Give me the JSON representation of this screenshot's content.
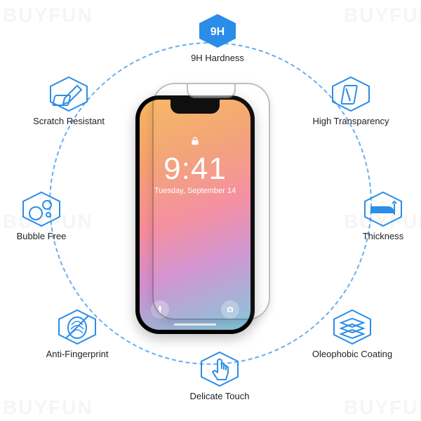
{
  "watermark": "BUYFUN",
  "phone": {
    "time": "9:41",
    "date": "Tuesday, September 14"
  },
  "features": {
    "hardness": {
      "label": "9H Hardness",
      "icon": "nine-h-icon"
    },
    "transparency": {
      "label": "High Transparency",
      "icon": "transparency-icon"
    },
    "thickness": {
      "label": "Thickness",
      "icon": "thickness-icon"
    },
    "oleophobic": {
      "label": "Oleophobic Coating",
      "icon": "layers-icon"
    },
    "touch": {
      "label": "Delicate Touch",
      "icon": "touch-icon"
    },
    "antiFingerprint": {
      "label": "Anti-Fingerprint",
      "icon": "fingerprint-icon"
    },
    "bubbleFree": {
      "label": "Bubble Free",
      "icon": "bubbles-icon"
    },
    "scratch": {
      "label": "Scratch Resistant",
      "icon": "scratch-icon"
    }
  },
  "colors": {
    "accent": "#2a8de8"
  }
}
